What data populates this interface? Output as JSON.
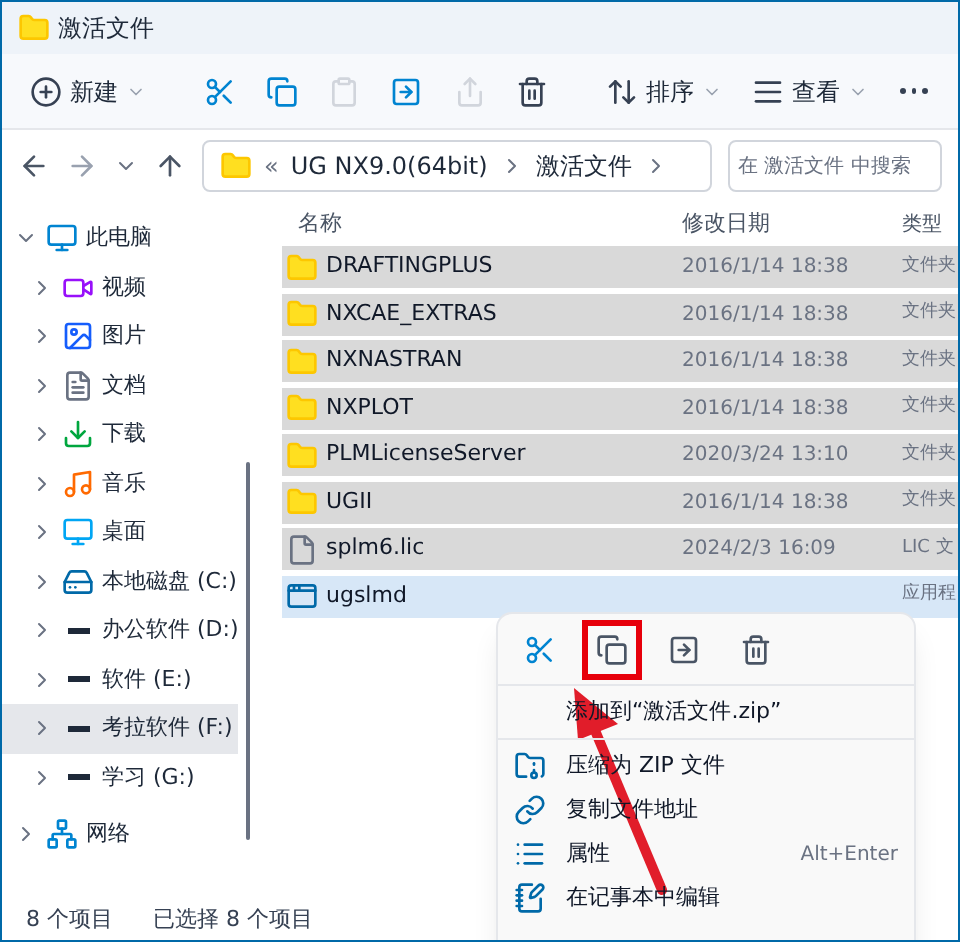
{
  "window": {
    "title": "激活文件"
  },
  "toolbar": [
    {
      "kind": "menu",
      "label": "新建",
      "disabled": false
    },
    {
      "kind": "icon",
      "disabled": false
    },
    {
      "kind": "icon",
      "disabled": false
    },
    {
      "kind": "icon",
      "disabled": true
    },
    {
      "kind": "icon",
      "disabled": false
    },
    {
      "kind": "icon",
      "disabled": true
    },
    {
      "kind": "icon",
      "disabled": false
    },
    {
      "kind": "menu",
      "label": "排序",
      "disabled": false
    },
    {
      "kind": "menu",
      "label": "查看",
      "disabled": false
    },
    {
      "kind": "more",
      "disabled": false
    }
  ],
  "address": {
    "overflow": "«",
    "path": [
      "UG NX9.0(64bit)",
      "激活文件"
    ]
  },
  "search": {
    "placeholder": "在 激活文件 中搜索"
  },
  "nav": [
    {
      "label": "此电脑",
      "expanded": true,
      "selected": false,
      "children": [
        {
          "label": "视频",
          "expanded": false,
          "selected": false
        },
        {
          "label": "图片",
          "expanded": false,
          "selected": false
        },
        {
          "label": "文档",
          "expanded": false,
          "selected": false
        },
        {
          "label": "下载",
          "expanded": false,
          "selected": false
        },
        {
          "label": "音乐",
          "expanded": false,
          "selected": false
        },
        {
          "label": "桌面",
          "expanded": false,
          "selected": false
        },
        {
          "label": "本地磁盘 (C:)",
          "expanded": false,
          "selected": false
        },
        {
          "label": "办公软件 (D:)",
          "expanded": false,
          "selected": false
        },
        {
          "label": "软件 (E:)",
          "expanded": false,
          "selected": false
        },
        {
          "label": "考拉软件 (F:)",
          "expanded": false,
          "selected": true
        },
        {
          "label": "学习 (G:)",
          "expanded": false,
          "selected": false
        }
      ]
    },
    {
      "label": "网络",
      "expanded": false,
      "selected": false
    }
  ],
  "table": {
    "columns": [
      "名称",
      "修改日期",
      "类型"
    ],
    "rows": [
      {
        "kind": "folder",
        "name": "DRAFTINGPLUS",
        "date": "2016/1/14 18:38",
        "type": "文件夹",
        "selected": true,
        "focused": false
      },
      {
        "kind": "folder",
        "name": "NXCAE_EXTRAS",
        "date": "2016/1/14 18:38",
        "type": "文件夹",
        "selected": true,
        "focused": false
      },
      {
        "kind": "folder",
        "name": "NXNASTRAN",
        "date": "2016/1/14 18:38",
        "type": "文件夹",
        "selected": true,
        "focused": false
      },
      {
        "kind": "folder",
        "name": "NXPLOT",
        "date": "2016/1/14 18:38",
        "type": "文件夹",
        "selected": true,
        "focused": false
      },
      {
        "kind": "folder",
        "name": "PLMLicenseServer",
        "date": "2020/3/24 13:10",
        "type": "文件夹",
        "selected": true,
        "focused": false
      },
      {
        "kind": "folder",
        "name": "UGII",
        "date": "2016/1/14 18:38",
        "type": "文件夹",
        "selected": true,
        "focused": false
      },
      {
        "kind": "file",
        "name": "splm6.lic",
        "date": "2024/2/3 16:09",
        "type": "LIC 文",
        "selected": true,
        "focused": false
      },
      {
        "kind": "app",
        "name": "ugslmd",
        "type": "应用程",
        "selected": true,
        "focused": true
      }
    ]
  },
  "context_menu": {
    "icons": [
      {
        "highlighted": false
      },
      {
        "highlighted": true
      },
      {
        "highlighted": false
      },
      {
        "highlighted": false
      }
    ],
    "groups": [
      [
        {
          "label": "添加到“激活文件.zip”"
        }
      ],
      [
        {
          "label": "压缩为 ZIP 文件"
        },
        {
          "label": "复制文件地址"
        },
        {
          "label": "属性",
          "shortcut": "Alt+Enter"
        },
        {
          "label": "在记事本中编辑"
        }
      ]
    ]
  },
  "status_bar": {
    "count": "8 个项目",
    "selection": "已选择 8 个项目"
  }
}
